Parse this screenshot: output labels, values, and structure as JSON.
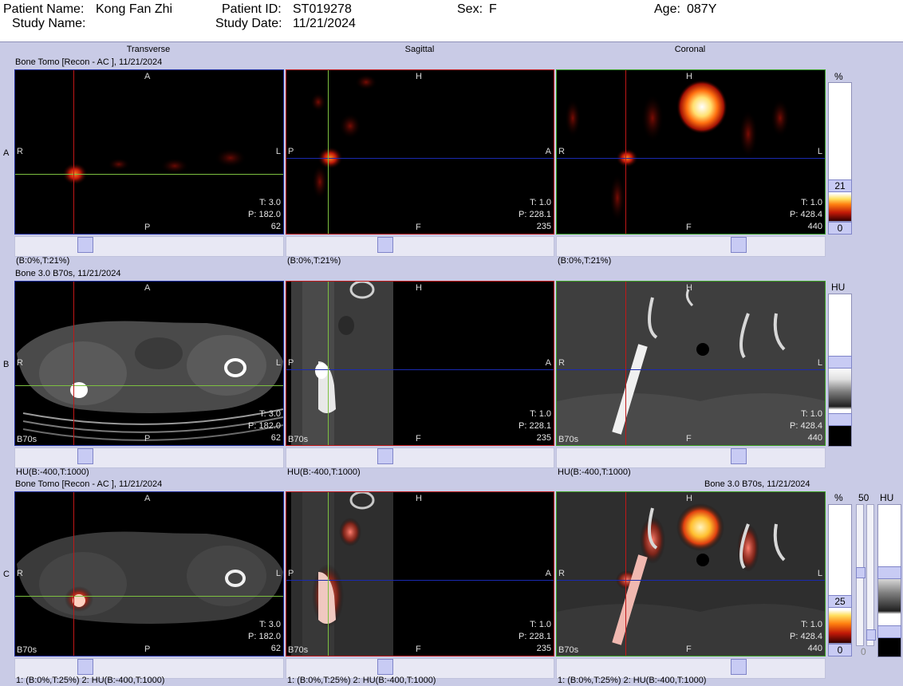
{
  "header": {
    "patient_name_label": "Patient Name:",
    "patient_name": "Kong Fan Zhi",
    "patient_id_label": "Patient ID:",
    "patient_id": "ST019278",
    "sex_label": "Sex:",
    "sex": "F",
    "age_label": "Age:",
    "age": "087Y",
    "study_name_label": "Study Name:",
    "study_name": "",
    "study_date_label": "Study Date:",
    "study_date": "11/21/2024"
  },
  "columns": [
    "Transverse",
    "Sagittal",
    "Coronal"
  ],
  "rows": [
    {
      "letter": "A",
      "title": "Bone Tomo [Recon - AC ], 11/21/2024",
      "title_right": "",
      "window_labels": [
        "(B:0%,T:21%)",
        "(B:0%,T:21%)",
        "(B:0%,T:21%)"
      ],
      "kernel": "",
      "colorbar": {
        "unit": "%",
        "value_top": "21",
        "value_bottom": "0"
      }
    },
    {
      "letter": "B",
      "title": "Bone  3.0  B70s, 11/21/2024",
      "title_right": "",
      "window_labels": [
        "HU(B:-400,T:1000)",
        "HU(B:-400,T:1000)",
        "HU(B:-400,T:1000)"
      ],
      "kernel": "B70s",
      "colorbar": {
        "unit": "HU"
      }
    },
    {
      "letter": "C",
      "title": "Bone Tomo [Recon - AC ], 11/21/2024",
      "title_right": "Bone  3.0  B70s, 11/21/2024",
      "window_labels": [
        "1: (B:0%,T:25%)    2: HU(B:-400,T:1000)",
        "1: (B:0%,T:25%)    2: HU(B:-400,T:1000)",
        "1: (B:0%,T:25%)    2: HU(B:-400,T:1000)"
      ],
      "kernel": "B70s",
      "colorbar": {
        "unit": "%",
        "value_top": "25",
        "value_bottom": "0",
        "blend_top": "50",
        "blend_bottom": "0",
        "unit2": "HU"
      }
    }
  ],
  "views": {
    "transverse": {
      "top": "A",
      "bottom": "P",
      "left": "R",
      "right": "L",
      "t": "T: 3.0",
      "p": "P: 182.0",
      "slice": "62"
    },
    "sagittal": {
      "top": "H",
      "bottom": "F",
      "left": "P",
      "right": "A",
      "t": "T: 1.0",
      "p": "P: 228.1",
      "slice": "235"
    },
    "coronal": {
      "top": "H",
      "bottom": "F",
      "left": "R",
      "right": "L",
      "t": "T: 1.0",
      "p": "P: 428.4",
      "slice": "440"
    }
  },
  "colors": {
    "background": "#c9cbe6",
    "crosshair_red": "#c01818",
    "crosshair_green": "#7cc040",
    "crosshair_blue": "#1a2ab0",
    "thumb": "#c8cbf4"
  }
}
